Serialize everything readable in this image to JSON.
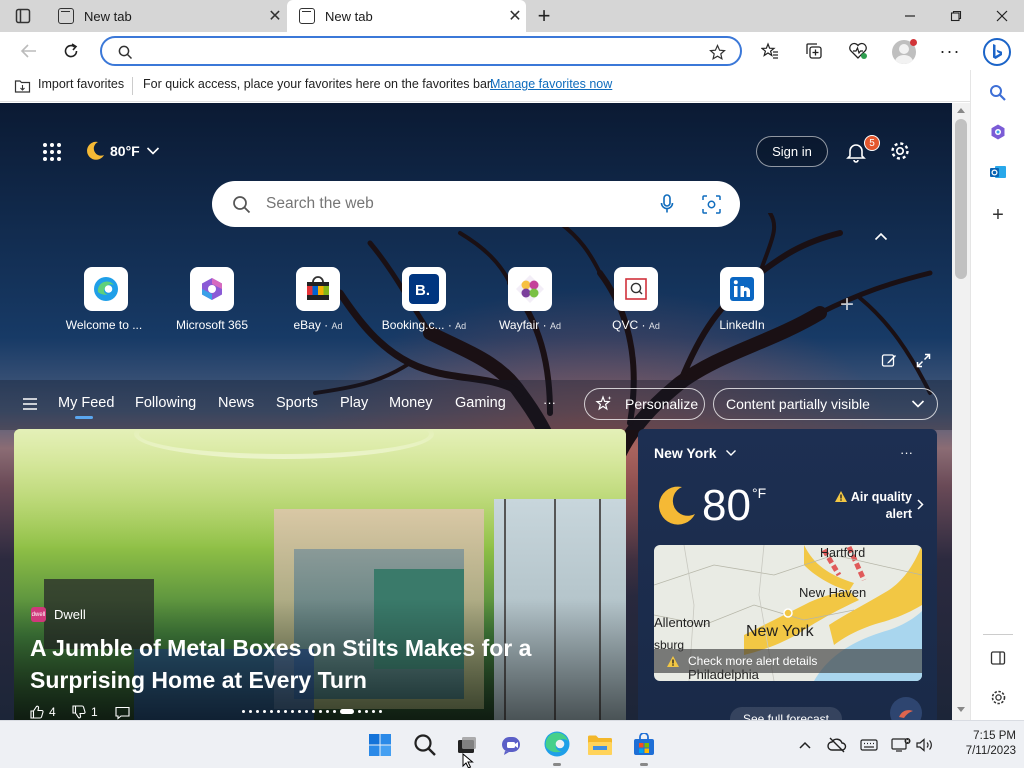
{
  "browser": {
    "tabs": [
      {
        "title": "New tab"
      },
      {
        "title": "New tab"
      }
    ],
    "address": {
      "value": ""
    }
  },
  "favorites_bar": {
    "import_label": "Import favorites",
    "message": "For quick access, place your favorites here on the favorites bar.",
    "manage_link": "Manage favorites now"
  },
  "newtab": {
    "weather_temp": "80°F",
    "sign_in": "Sign in",
    "notifications_count": "5",
    "search_placeholder": "Search the web",
    "quick_links": [
      {
        "label": "Welcome to ...",
        "ad": ""
      },
      {
        "label": "Microsoft 365",
        "ad": ""
      },
      {
        "label": "eBay",
        "ad": "Ad"
      },
      {
        "label": "Booking.c...",
        "ad": "Ad"
      },
      {
        "label": "Wayfair",
        "ad": "Ad"
      },
      {
        "label": "QVC",
        "ad": "Ad"
      },
      {
        "label": "LinkedIn",
        "ad": ""
      }
    ],
    "feed_tabs": [
      "My Feed",
      "Following",
      "News",
      "Sports",
      "Play",
      "Money",
      "Gaming"
    ],
    "more": "···",
    "personalize": "Personalize",
    "content_visibility": "Content partially visible",
    "hero": {
      "source": "Dwell",
      "title_line1": "A Jumble of Metal Boxes on Stilts Makes for a",
      "title_line2": "Surprising Home at Every Turn",
      "likes": "4",
      "dislikes": "1"
    },
    "weather": {
      "city": "New York",
      "temp": "80",
      "unit": "°F",
      "alert_line1": "Air quality",
      "alert_line2": "alert",
      "map_labels": {
        "hartford": "Hartford",
        "new_haven": "New Haven",
        "allentown": "Allentown",
        "new_york": "New York",
        "burg": "sburg",
        "philadelphia": "Philadelphia"
      },
      "alert_details": "Check more alert details",
      "full_forecast": "See full forecast"
    }
  },
  "taskbar": {
    "time": "7:15 PM",
    "date": "7/11/2023"
  },
  "colors": {
    "accent": "#0f6cbd",
    "notification_badge": "#e4572e",
    "alert_yellow": "#f2c744",
    "map_water": "#a9d6ee",
    "map_land": "#e9ebe4"
  }
}
